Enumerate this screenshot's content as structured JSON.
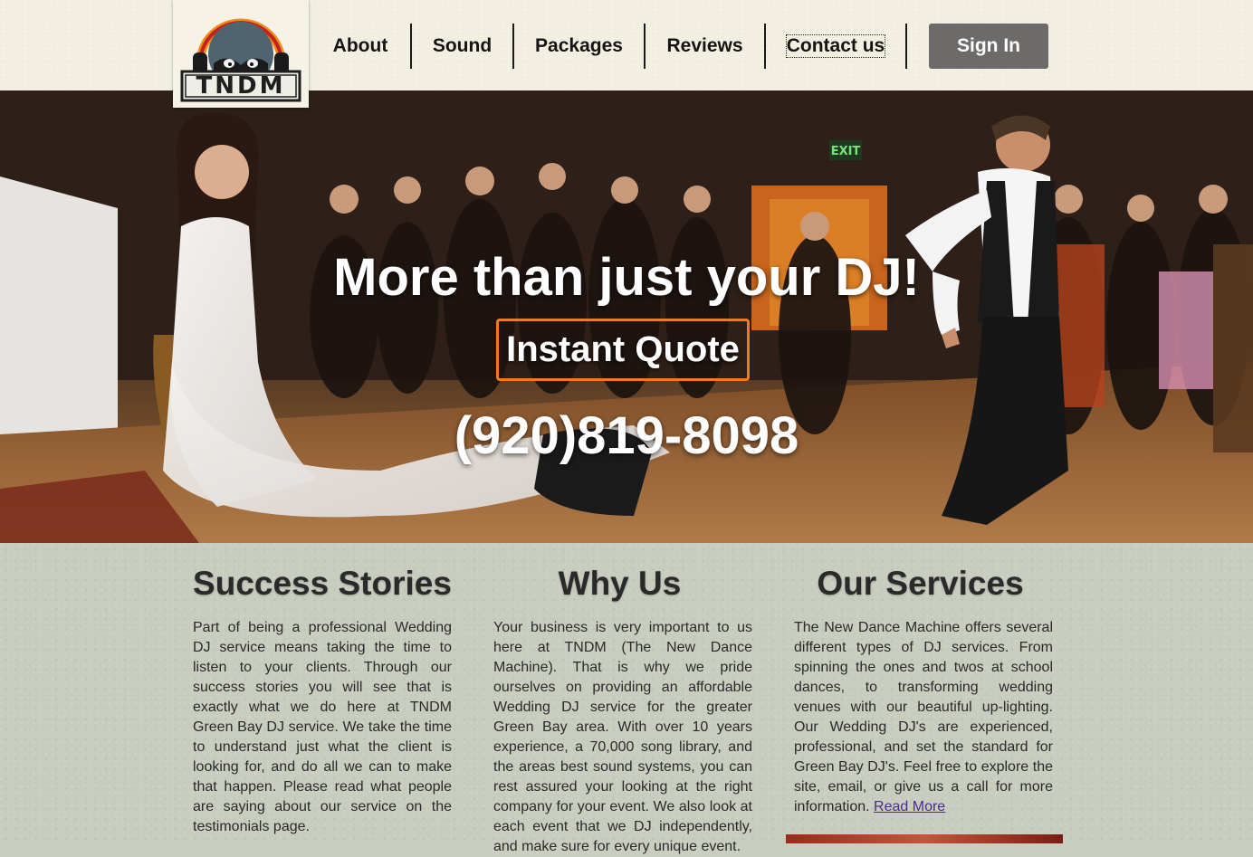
{
  "header": {
    "logo_text": "TNDM",
    "nav": [
      {
        "label": "About"
      },
      {
        "label": "Sound"
      },
      {
        "label": "Packages"
      },
      {
        "label": "Reviews"
      },
      {
        "label": "Contact us"
      }
    ],
    "sign_in_label": "Sign In"
  },
  "hero": {
    "title": "More than just your DJ!",
    "quote_button_label": "Instant Quote",
    "phone": "(920)819-8098",
    "exit_sign": "EXIT"
  },
  "sections": {
    "success": {
      "heading": "Success Stories",
      "body": "Part of being a professional Wedding DJ service means taking the time to listen to your clients. Through our success stories you will see that is exactly what we do here at TNDM Green Bay DJ service. We take the time to understand just what the client is looking for, and do all we can to make that happen. Please read what people are saying about our service on the testimonials page."
    },
    "why": {
      "heading": "Why Us",
      "body": "Your business is very important to us here at TNDM (The New Dance Machine). That is why we pride ourselves on providing an affordable Wedding DJ service for the greater Green Bay area. With over 10 years experience, a 70,000 song library, and the areas best sound systems, you can rest assured your looking at the right company for your event. We also look at each event that we DJ independently, and make sure for every unique event."
    },
    "services": {
      "heading": "Our Services",
      "body": "The New Dance Machine offers several different types of DJ services. From spinning the ones and twos at school dances, to transforming wedding venues with our beautiful up-lighting. Our Wedding DJ's are experienced, professional, and set the standard for Green Bay DJ's. Feel free to explore the site, email, or give us a call for more information.",
      "read_more_label": "Read More"
    }
  },
  "colors": {
    "header_bg": "#f3f0e2",
    "accent_orange": "#f07d1a",
    "sign_in_bg": "#6c6b69",
    "content_bg": "#c8cdc0",
    "link": "#4b2b8f"
  }
}
